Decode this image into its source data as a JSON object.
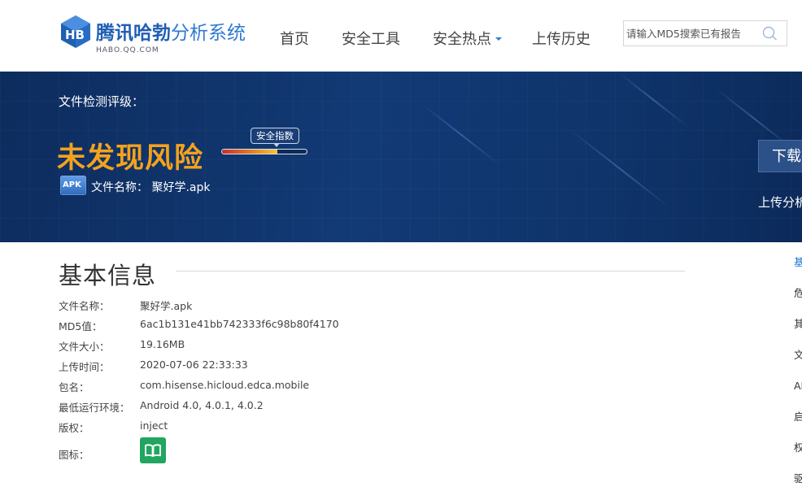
{
  "brand": {
    "title_part1": "腾讯哈勃",
    "title_part2": "分析系统",
    "subtitle": "HABO.QQ.COM",
    "color_primary": "#1f5fb4"
  },
  "nav": {
    "items": [
      {
        "label": "首页"
      },
      {
        "label": "安全工具"
      },
      {
        "label": "安全热点",
        "has_dropdown": true
      },
      {
        "label": "上传历史"
      }
    ]
  },
  "search": {
    "placeholder": "请输入MD5搜索已有报告",
    "icon": "search-icon"
  },
  "banner": {
    "rating_label": "文件检测评级：",
    "verdict": "未发现风险",
    "verdict_color": "#f4a21c",
    "score_tag": "安全指数",
    "score_level": 0.65,
    "file_icon_label": "APK",
    "file_name_label": "文件名称：",
    "file_name": "聚好学.apk",
    "download_button": "下载报告",
    "upload_analysis": "上传分析"
  },
  "basic_info": {
    "title": "基本信息",
    "rows": [
      {
        "key": "文件名称：",
        "value": "聚好学.apk"
      },
      {
        "key": "MD5值：",
        "value": "6ac1b131e41bb742333f6c98b80f4170"
      },
      {
        "key": "文件大小：",
        "value": "19.16MB"
      },
      {
        "key": "上传时间：",
        "value": "2020-07-06 22:33:33"
      },
      {
        "key": "包名：",
        "value": "com.hisense.hicloud.edca.mobile"
      },
      {
        "key": "最低运行环境：",
        "value": "Android 4.0, 4.0.1, 4.0.2"
      },
      {
        "key": "版权：",
        "value": "inject"
      }
    ],
    "icon_row_key": "图标：",
    "icon_name": "book-icon",
    "icon_color": "#21a561"
  },
  "side_nav": {
    "items": [
      {
        "label": "基本信息",
        "active": true
      },
      {
        "label": "危险行为"
      },
      {
        "label": "其他行为"
      },
      {
        "label": "文件操作"
      },
      {
        "label": "API调用"
      },
      {
        "label": "启动信息"
      },
      {
        "label": "权限信息"
      },
      {
        "label": "驱动信息"
      }
    ]
  }
}
